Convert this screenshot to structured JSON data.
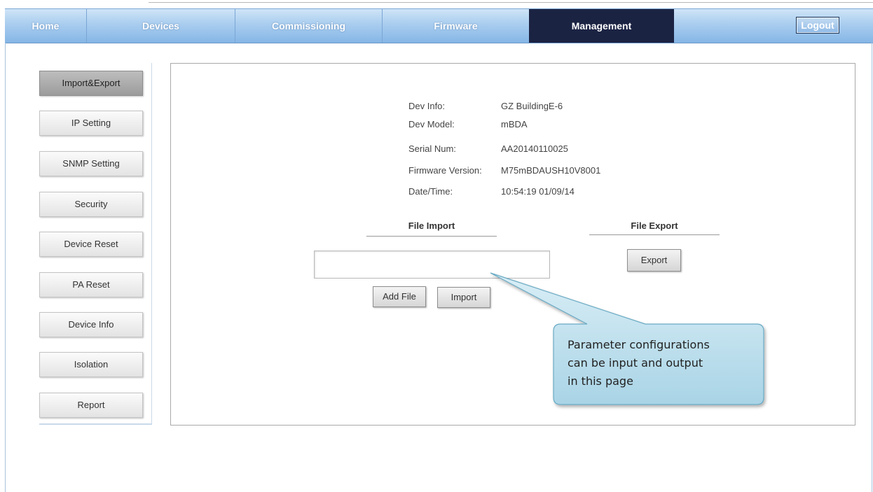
{
  "nav": {
    "home": "Home",
    "devices": "Devices",
    "commissioning": "Commissioning",
    "firmware": "Firmware",
    "management": "Management",
    "logout": "Logout",
    "active": "Management"
  },
  "sidebar": {
    "items": [
      {
        "label": "Import&Export",
        "active": true
      },
      {
        "label": "IP Setting"
      },
      {
        "label": "SNMP Setting"
      },
      {
        "label": "Security"
      },
      {
        "label": "Device Reset"
      },
      {
        "label": "PA Reset"
      },
      {
        "label": "Device Info"
      },
      {
        "label": "Isolation"
      },
      {
        "label": "Report"
      }
    ]
  },
  "device_info": [
    {
      "label": "Dev Info:",
      "value": "GZ BuildingE-6"
    },
    {
      "label": "Dev Model:",
      "value": "mBDA"
    },
    {
      "label": "Serial Num:",
      "value": "AA20140110025"
    },
    {
      "label": "Firmware Version:",
      "value": "M75mBDAUSH10V8001"
    },
    {
      "label": "Date/Time:",
      "value": "10:54:19 01/09/14"
    }
  ],
  "file_import": {
    "title": "File Import",
    "path_value": "",
    "add_file_label": "Add File",
    "import_label": "Import"
  },
  "file_export": {
    "title": "File Export",
    "export_label": "Export"
  },
  "callout": {
    "line1": "Parameter configurations",
    "line2": "can be input and output",
    "line3": "in this page"
  },
  "colors": {
    "nav_active": "#1b2343",
    "nav_gradient_top": "#cfe4f7",
    "nav_gradient_bottom": "#85b6e6",
    "callout_fill": "#c2e1ee",
    "callout_border": "#6aaac4"
  }
}
